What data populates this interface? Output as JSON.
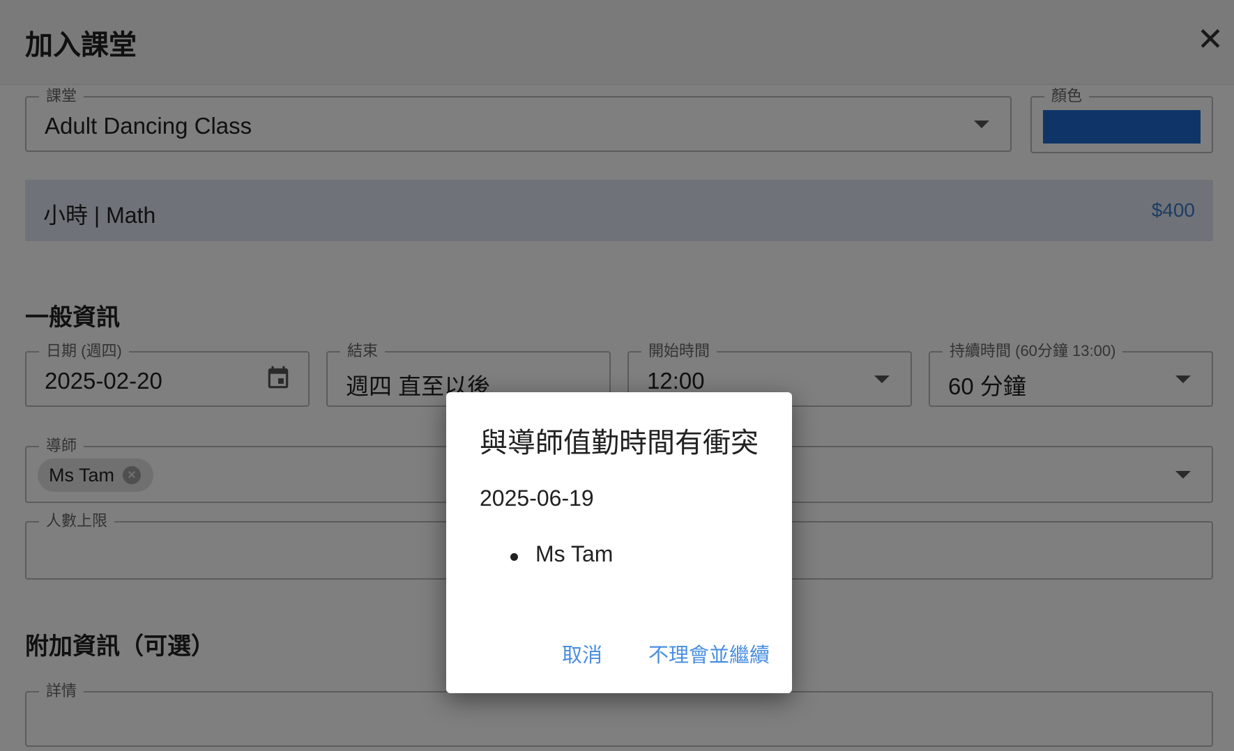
{
  "header": {
    "title": "加入課堂",
    "close_label": "✕"
  },
  "course": {
    "label": "課堂",
    "value": "Adult Dancing Class"
  },
  "color": {
    "label": "顏色",
    "swatch": "#1f6ad0"
  },
  "rate": {
    "label": "小時 | Math",
    "price": "$400"
  },
  "general": {
    "title": "一般資訊"
  },
  "date": {
    "label": "日期 (週四)",
    "value": "2025-02-20"
  },
  "end": {
    "label": "結束",
    "value": "週四 直至以後"
  },
  "start_time": {
    "label": "開始時間",
    "value": "12:00"
  },
  "duration": {
    "label": "持續時間 (60分鐘 13:00)",
    "value": "60 分鐘"
  },
  "tutor": {
    "label": "導師",
    "chips": [
      "Ms Tam"
    ]
  },
  "capacity": {
    "label": "人數上限",
    "value": ""
  },
  "additional": {
    "title": "附加資訊（可選）"
  },
  "details": {
    "label": "詳情",
    "value": ""
  },
  "dialog": {
    "title": "與導師值勤時間有衝突",
    "date": "2025-06-19",
    "conflicts": [
      "Ms Tam"
    ],
    "cancel_label": "取消",
    "continue_label": "不理會並繼續"
  }
}
